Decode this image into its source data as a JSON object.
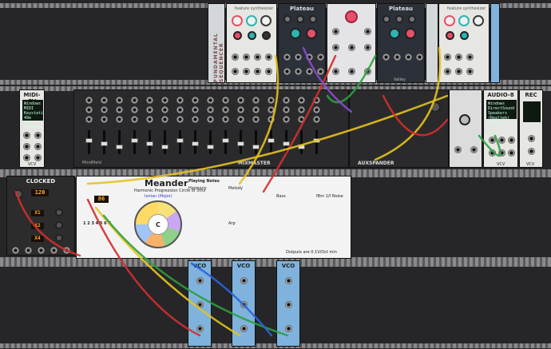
{
  "modules": {
    "plateau_left": {
      "title": "Plateau"
    },
    "plateau_right": {
      "title": "Plateau"
    },
    "plateau_subtitle": "Valley",
    "feature_left": {
      "subtitle": "feature synthesizer"
    },
    "feature_right": {
      "subtitle": "feature synthesizer"
    },
    "vert_left": "FUNDAMENTAL SEQUENCER",
    "midi_cv": {
      "title": "MIDI-CV",
      "lines": [
        "Windows MIDI",
        "Keystation 49e",
        "All channels"
      ]
    },
    "mixmaster": {
      "title": "MIXMASTER",
      "brand": "MindMeld"
    },
    "auxspander": {
      "title": "AUXSPANDER"
    },
    "audio8": {
      "title": "AUDIO-8",
      "lines": [
        "Windows DirectSound",
        "Speakers (Realtek)",
        "1-8 out"
      ]
    },
    "rec": {
      "title": "REC"
    },
    "clocked": {
      "title": "CLOCKED",
      "bpm": "120",
      "ratio1": "X1",
      "ratio2": "X2",
      "ratio3": "X4"
    },
    "meander": {
      "title": "Meander",
      "subtitle": "Harmonic Progression Circle of 5ths",
      "mode_label": "Ionian (Major)",
      "root": "C",
      "key_display": "86",
      "playing_notes": "Playing Notes",
      "degrees": "1 2 3 4 5 6 7",
      "footer": "Outputs are 0.1V/Oct min",
      "section_harmony": "Harmony",
      "section_melody": "Melody",
      "section_bass": "Bass",
      "section_arp": "Arp",
      "section_fbm": "fBm 1/f Noise"
    },
    "vco_a": {
      "title": "VCO"
    },
    "vco_b": {
      "title": "VCO"
    },
    "vco_c": {
      "title": "VCO"
    },
    "rack_brand": "VCV"
  },
  "colors": {
    "cable_red": "#d32f2f",
    "cable_yellow": "#e7c21e",
    "cable_green": "#2e9e3e",
    "cable_blue": "#2a64d8",
    "cable_purple": "#8a4bd0",
    "accent_orange": "#ffb020",
    "meander_purple": "#6a4fd3"
  }
}
